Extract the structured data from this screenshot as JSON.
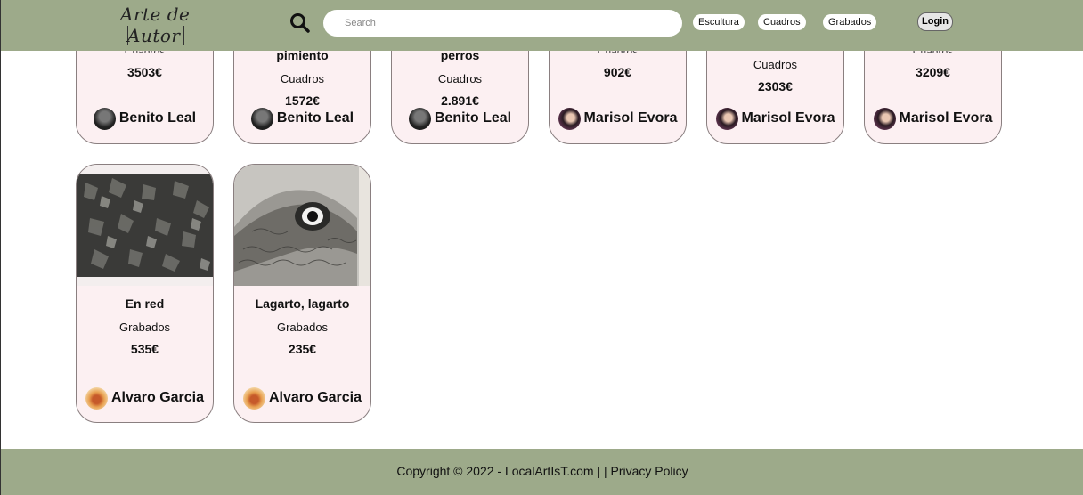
{
  "header": {
    "logo_line1": "Arte de",
    "logo_line2": "Autor",
    "search_placeholder": "Search",
    "nav": [
      "Escultura",
      "Cuadros",
      "Grabados"
    ],
    "login_label": "Login",
    "search_icon": "search-icon"
  },
  "row1": [
    {
      "category": "Cuadros",
      "price": "3503€",
      "artist": "Benito Leal"
    },
    {
      "title": "pimiento",
      "category": "Cuadros",
      "price": "1572€",
      "artist": "Benito Leal"
    },
    {
      "title": "perros",
      "category": "Cuadros",
      "price": "2.891€",
      "artist": "Benito Leal"
    },
    {
      "category": "Cuadros",
      "price": "902€",
      "artist": "Marisol Evora"
    },
    {
      "category": "Cuadros",
      "price": "2303€",
      "artist": "Marisol Evora"
    },
    {
      "category": "Cuadros",
      "price": "3209€",
      "artist": "Marisol Evora"
    }
  ],
  "row2": [
    {
      "title": "En red",
      "category": "Grabados",
      "price": "535€",
      "artist": "Alvaro Garcia"
    },
    {
      "title": "Lagarto, lagarto",
      "category": "Grabados",
      "price": "235€",
      "artist": "Alvaro Garcia"
    }
  ],
  "footer": {
    "copyright": "Copyright © 2022 - LocalArtIsT.com",
    "separator": "| |",
    "privacy": "Privacy Policy"
  },
  "colors": {
    "header_bg": "#9daa8a",
    "card_bg": "#fcf0f2",
    "footer_bg": "#9daa8a"
  }
}
